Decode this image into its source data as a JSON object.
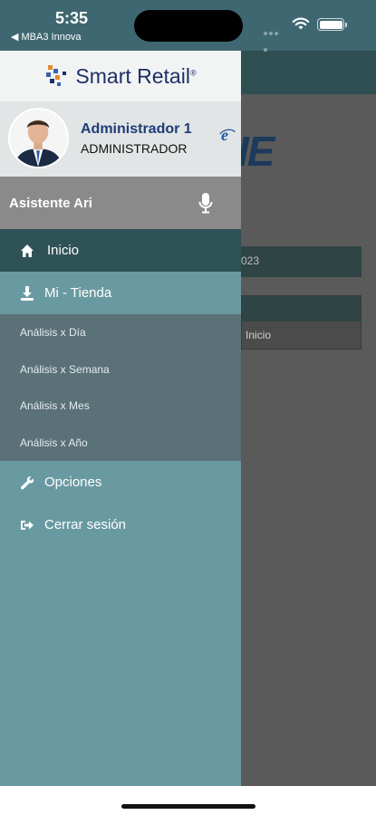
{
  "status_bar": {
    "time": "5:35",
    "back_app": "◀ MBA3 Innova"
  },
  "background": {
    "date_fragment": "023",
    "card_text": "Inicio",
    "logo_fragment": "IE"
  },
  "brand": {
    "name": "Smart Retail",
    "mark": "®"
  },
  "profile": {
    "name": "Administrador 1",
    "role": "ADMINISTRADOR"
  },
  "assistant": {
    "label": "Asistente Ari"
  },
  "menu": {
    "inicio": "Inicio",
    "tienda": "Mi - Tienda",
    "sub": [
      "Análisis x Día",
      "Análisis x Semana",
      "Análisis x Mes",
      "Análisis x Año"
    ],
    "opciones": "Opciones",
    "logout": "Cerrar sesión"
  },
  "colors": {
    "active": "#2f5257",
    "drawer": "#6a9aa1",
    "submenu": "#5b7178",
    "brand": "#1f2f66"
  }
}
